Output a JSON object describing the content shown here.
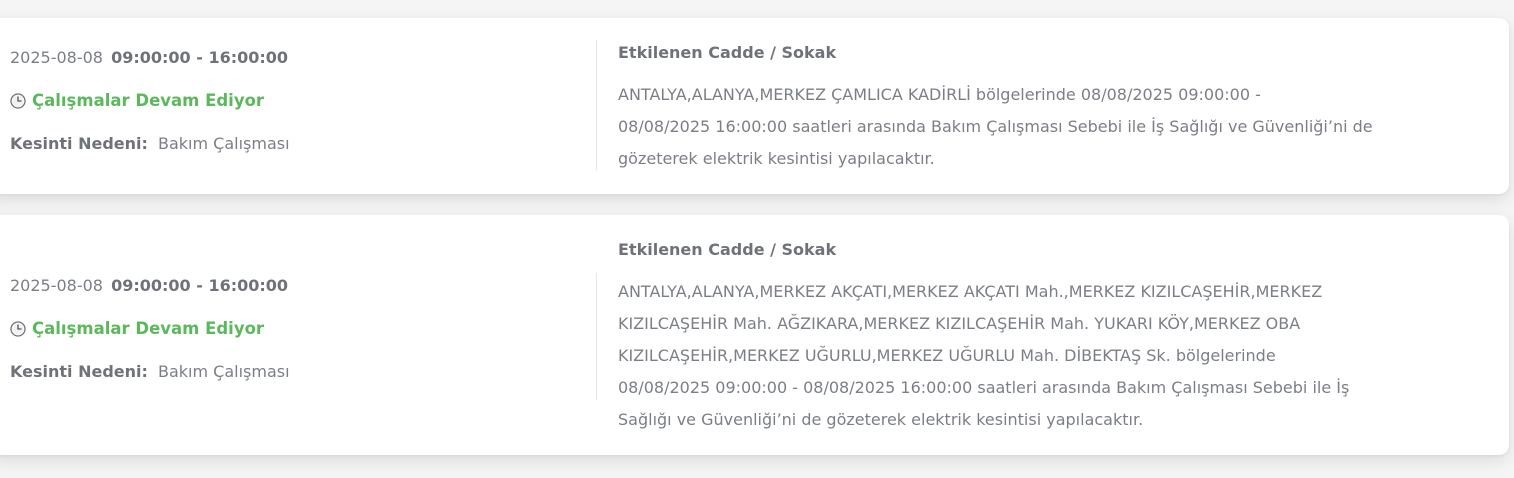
{
  "cards": [
    {
      "date": "2025-08-08",
      "time_range": "09:00:00 - 16:00:00",
      "status_icon": "clock-icon",
      "status": "Çalışmalar Devam Ediyor",
      "reason_label": "Kesinti Nedeni:",
      "reason": "Bakım Çalışması",
      "streets_title": "Etkilenen Cadde / Sokak",
      "streets_lines": [
        "ANTALYA,ALANYA,MERKEZ ÇAMLICA KADİRLİ bölgelerinde 08/08/2025 09:00:00 -",
        "08/08/2025 16:00:00 saatleri arasında Bakım Çalışması Sebebi ile İş Sağlığı ve Güvenliği’ni de",
        "gözeterek elektrik kesintisi yapılacaktır."
      ]
    },
    {
      "date": "2025-08-08",
      "time_range": "09:00:00 - 16:00:00",
      "status_icon": "clock-icon",
      "status": "Çalışmalar Devam Ediyor",
      "reason_label": "Kesinti Nedeni:",
      "reason": "Bakım Çalışması",
      "streets_title": "Etkilenen Cadde / Sokak",
      "streets_lines": [
        "ANTALYA,ALANYA,MERKEZ AKÇATI,MERKEZ AKÇATI Mah.,MERKEZ KIZILCAŞEHİR,MERKEZ",
        "KIZILCAŞEHİR Mah. AĞZIKARA,MERKEZ KIZILCAŞEHİR Mah. YUKARI KÖY,MERKEZ OBA",
        "KIZILCAŞEHİR,MERKEZ UĞURLU,MERKEZ UĞURLU Mah. DİBEKTAŞ Sk. bölgelerinde",
        "08/08/2025 09:00:00 - 08/08/2025 16:00:00 saatleri arasında Bakım Çalışması Sebebi ile İş",
        "Sağlığı ve Güvenliği’ni de gözeterek elektrik kesintisi yapılacaktır."
      ]
    }
  ],
  "colors": {
    "status_green": "#5cb85c",
    "text_gray": "#7b7f85",
    "card_bg": "#ffffff",
    "page_bg": "#f5f5f5"
  }
}
